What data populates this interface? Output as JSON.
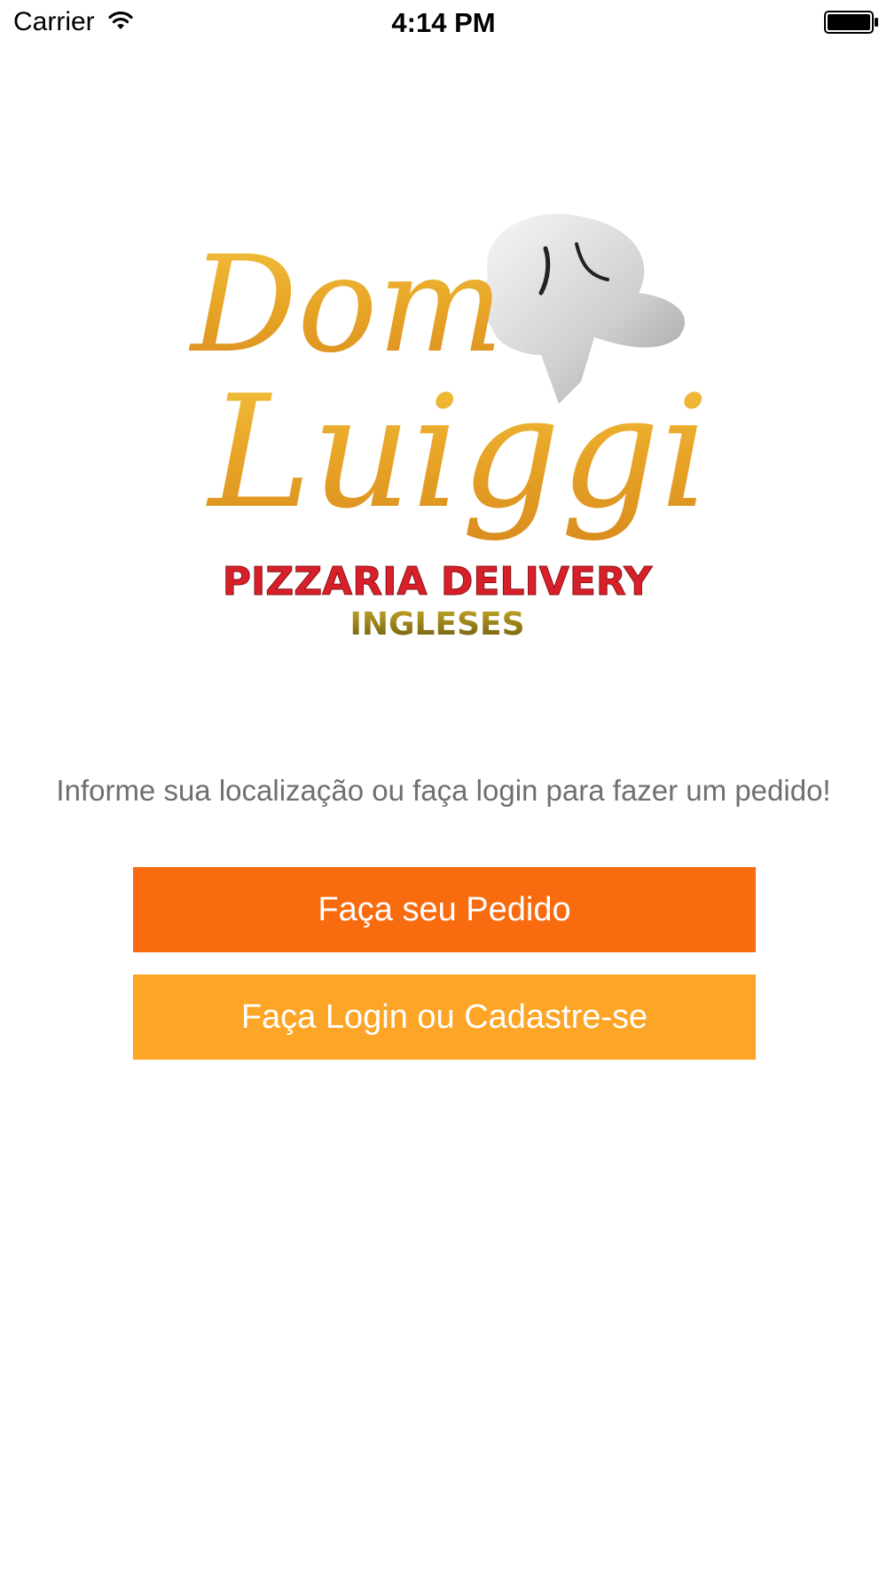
{
  "status_bar": {
    "carrier": "Carrier",
    "time": "4:14 PM"
  },
  "logo": {
    "line1": "Dom",
    "line2": "Luiggi",
    "line3": "PIZZARIA DELIVERY",
    "line4": "INGLESES",
    "colors": {
      "gold": "#e8a527",
      "red": "#d8202a",
      "olive": "#9a8516"
    }
  },
  "main": {
    "prompt": "Informe sua localização ou faça login para fazer um pedido!",
    "order_button": "Faça seu Pedido",
    "login_button": "Faça Login ou Cadastre-se"
  },
  "colors": {
    "order_button": "#f86b0f",
    "login_button": "#fda526",
    "prompt_text": "#6f6f6f"
  },
  "icons": {
    "wifi": "wifi-icon",
    "battery": "battery-icon"
  }
}
